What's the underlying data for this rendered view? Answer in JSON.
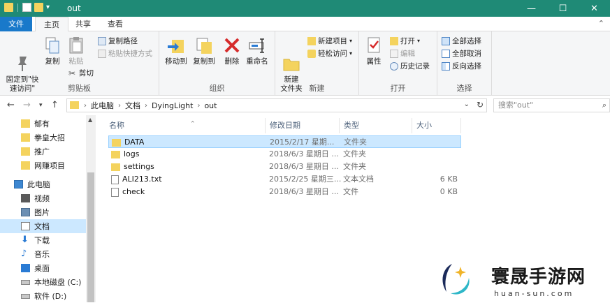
{
  "window": {
    "title": "out"
  },
  "window_controls": {
    "minimize": "—",
    "maximize": "☐",
    "close": "✕"
  },
  "tabs": [
    {
      "label": "文件"
    },
    {
      "label": "主页"
    },
    {
      "label": "共享"
    },
    {
      "label": "查看"
    }
  ],
  "ribbon": {
    "clipboard": {
      "label": "剪贴板",
      "pin": "固定到\"快\n速访问\"",
      "copy": "复制",
      "paste": "粘贴",
      "copy_path": "复制路径",
      "paste_shortcut": "粘贴快捷方式",
      "cut": "剪切"
    },
    "organize": {
      "label": "组织",
      "move_to": "移动到",
      "copy_to": "复制到",
      "delete": "删除",
      "rename": "重命名"
    },
    "new": {
      "label": "新建",
      "new_folder": "新建\n文件夹",
      "new_item": "新建项目",
      "easy_access": "轻松访问"
    },
    "open": {
      "label": "打开",
      "properties": "属性",
      "open": "打开",
      "edit": "编辑",
      "history": "历史记录"
    },
    "select": {
      "label": "选择",
      "select_all": "全部选择",
      "select_none": "全部取消",
      "invert": "反向选择"
    }
  },
  "address": {
    "crumbs": [
      "此电脑",
      "文档",
      "DyingLight",
      "out"
    ],
    "search_placeholder": "搜索\"out\""
  },
  "nav": {
    "items": [
      {
        "label": "郁有",
        "icon": "folder-icon"
      },
      {
        "label": "拳皇大招",
        "icon": "folder-icon"
      },
      {
        "label": "推广",
        "icon": "folder-icon"
      },
      {
        "label": "网赚项目",
        "icon": "folder-icon"
      },
      {
        "label": "此电脑",
        "icon": "computer-icon"
      },
      {
        "label": "视频",
        "icon": "video-icon"
      },
      {
        "label": "图片",
        "icon": "pictures-icon"
      },
      {
        "label": "文档",
        "icon": "documents-icon"
      },
      {
        "label": "下载",
        "icon": "download-icon"
      },
      {
        "label": "音乐",
        "icon": "music-icon"
      },
      {
        "label": "桌面",
        "icon": "desktop-icon"
      },
      {
        "label": "本地磁盘 (C:)",
        "icon": "drive-icon"
      },
      {
        "label": "软件 (D:)",
        "icon": "drive-icon"
      }
    ]
  },
  "columns": {
    "name": "名称",
    "date": "修改日期",
    "type": "类型",
    "size": "大小"
  },
  "files": [
    {
      "name": "DATA",
      "date": "2015/2/17 星期...",
      "type": "文件夹",
      "size": "",
      "kind": "folder"
    },
    {
      "name": "logs",
      "date": "2018/6/3 星期日 ...",
      "type": "文件夹",
      "size": "",
      "kind": "folder"
    },
    {
      "name": "settings",
      "date": "2018/6/3 星期日 ...",
      "type": "文件夹",
      "size": "",
      "kind": "folder"
    },
    {
      "name": "ALI213.txt",
      "date": "2015/2/25 星期三...",
      "type": "文本文档",
      "size": "6 KB",
      "kind": "txt"
    },
    {
      "name": "check",
      "date": "2018/6/3 星期日 ...",
      "type": "文件",
      "size": "0 KB",
      "kind": "file"
    }
  ],
  "watermark": {
    "text": "寰晟手游网",
    "url": "huan-sun.com"
  },
  "colors": {
    "titlebar": "#1f8a76",
    "file_tab": "#1979ca",
    "selection": "#cce8ff",
    "folder": "#f4d35e"
  }
}
